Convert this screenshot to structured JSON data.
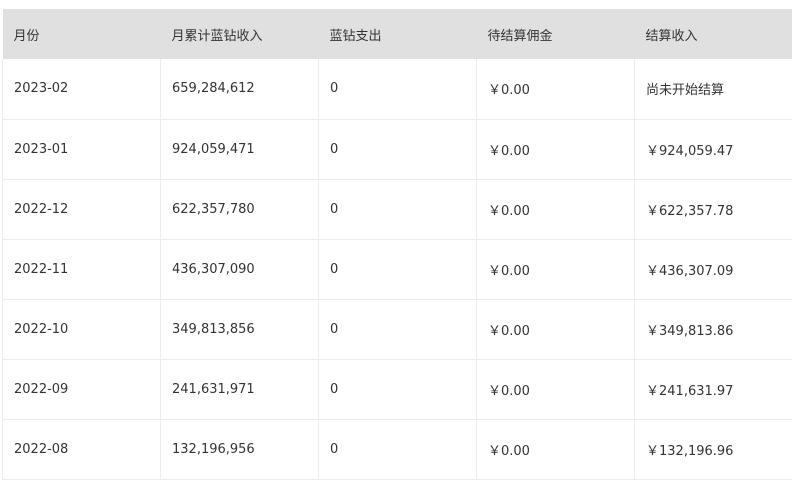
{
  "table": {
    "headers": [
      "月份",
      "月累计蓝钻收入",
      "蓝钻支出",
      "待结算佣金",
      "结算收入"
    ],
    "rows": [
      [
        "2023-02",
        "659,284,612",
        "0",
        "￥0.00",
        "尚未开始结算"
      ],
      [
        "2023-01",
        "924,059,471",
        "0",
        "￥0.00",
        "￥924,059.47"
      ],
      [
        "2022-12",
        "622,357,780",
        "0",
        "￥0.00",
        "￥622,357.78"
      ],
      [
        "2022-11",
        "436,307,090",
        "0",
        "￥0.00",
        "￥436,307.09"
      ],
      [
        "2022-10",
        "349,813,856",
        "0",
        "￥0.00",
        "￥349,813.86"
      ],
      [
        "2022-09",
        "241,631,971",
        "0",
        "￥0.00",
        "￥241,631.97"
      ],
      [
        "2022-08",
        "132,196,956",
        "0",
        "￥0.00",
        "￥132,196.96"
      ]
    ]
  },
  "colors": {
    "header_background": "#e0e0e0",
    "text": "#333333",
    "border": "#ececec"
  }
}
